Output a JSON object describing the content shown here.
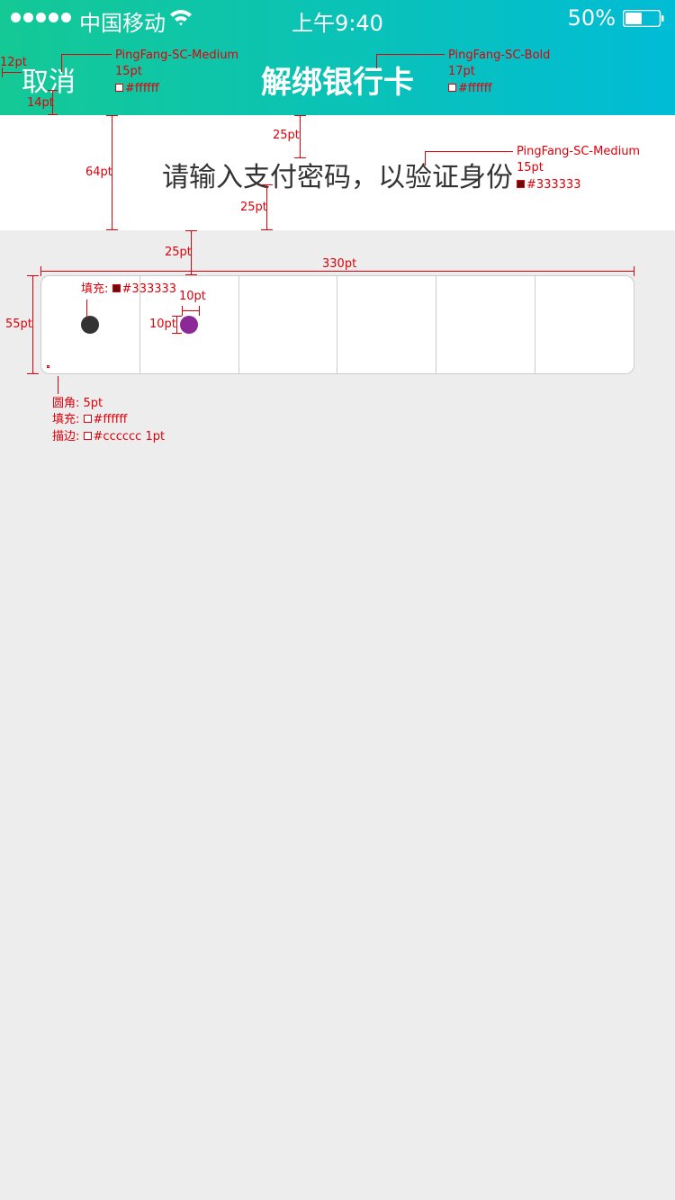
{
  "status_bar": {
    "carrier": "中国移动",
    "time": "上午9:40",
    "battery": "50%",
    "battery_level": 0.5
  },
  "nav": {
    "cancel_label": "取消",
    "title": "解绑银行卡"
  },
  "prompt": {
    "text": "请输入支付密码，以验证身份"
  },
  "password_box": {
    "cells": 6,
    "filled_color": "#333333",
    "active_color": "#8b2a97"
  },
  "colors": {
    "header_start": "#14c995",
    "header_end": "#00bcd6",
    "page_bg": "#ededed",
    "annotation": "#e0000a"
  },
  "annotations": {
    "cancel_font": "PingFang-SC-Medium",
    "cancel_size": "15pt",
    "cancel_color": "#ffffff",
    "title_font": "PingFang-SC-Bold",
    "title_size": "17pt",
    "title_color": "#ffffff",
    "prompt_font": "PingFang-SC-Medium",
    "prompt_size": "15pt",
    "prompt_color": "#333333",
    "left_margin": "12pt",
    "cancel_bottom": "14pt",
    "prompt_top_gap": "25pt",
    "prompt_bottom_gap": "25pt",
    "section_height": "64pt",
    "box_top_gap": "25pt",
    "box_width": "330pt",
    "box_height": "55pt",
    "dot_fill_label": "填充:",
    "dot_fill_color": "#333333",
    "dot_width": "10pt",
    "dot_height": "10pt",
    "radius_label": "圆角: 5pt",
    "fill_label": "填充:",
    "fill_color": "#ffffff",
    "stroke_label": "描边:",
    "stroke_value": "#cccccc  1pt"
  }
}
